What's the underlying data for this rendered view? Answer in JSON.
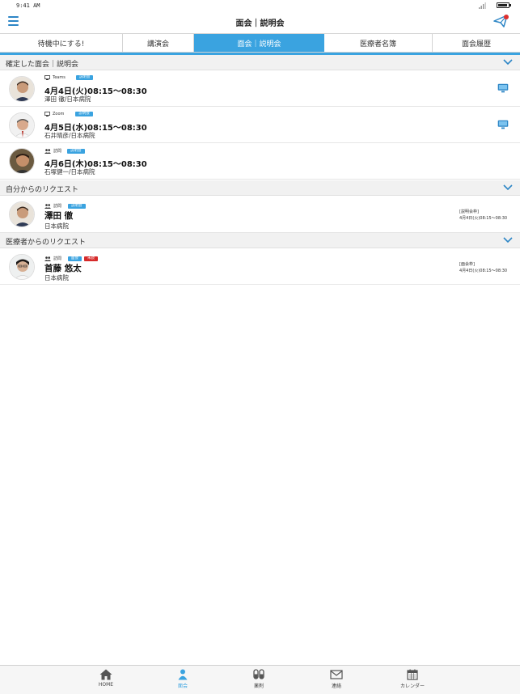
{
  "status_bar": {
    "time": "9:41 AM",
    "signal_icon": "signal-icon",
    "battery_icon": "battery-icon"
  },
  "header": {
    "title": "面会｜説明会",
    "menu_icon": "hamburger-menu-icon",
    "send_icon": "paper-plane-icon"
  },
  "tabs": [
    {
      "label": "待機中にする!",
      "active": false
    },
    {
      "label": "講演会",
      "active": false
    },
    {
      "label": "面会｜説明会",
      "active": true
    },
    {
      "label": "医療者名簿",
      "active": false
    },
    {
      "label": "面会履歴",
      "active": false
    }
  ],
  "confirmed": {
    "title": "確定した面会｜説明会",
    "items": [
      {
        "type": "Teams",
        "badge": "説明会",
        "when": "4月4日(火)08:15〜08:30",
        "sub": "澤田 徹/日本病院"
      },
      {
        "type": "Zoom",
        "badge": "説明会",
        "when": "4月5日(水)08:15〜08:30",
        "sub": "石井晴彦/日本病院"
      },
      {
        "type": "訪問",
        "badge": "説明会",
        "when": "4月6日(木)08:15〜08:30",
        "sub": "石塚健一/日本病院"
      }
    ]
  },
  "my_requests": {
    "title": "自分からのリクエスト",
    "items": [
      {
        "type": "訪問",
        "badge": "説明会",
        "name": "澤田 徹",
        "hospital": "日本病院",
        "note_label": "[説明会枠]",
        "note_time": "4月4日(火)08:15〜08:30"
      }
    ]
  },
  "their_requests": {
    "title": "医療者からのリクエスト",
    "items": [
      {
        "type": "訪問",
        "badge": "面会",
        "badge2": "未読",
        "name": "首藤 悠太",
        "hospital": "日本病院",
        "note_label": "[面会枠]",
        "note_time": "4月4日(火)08:15〜08:30"
      }
    ]
  },
  "bottom_nav": [
    {
      "label": "HOME",
      "icon": "home-icon",
      "active": false
    },
    {
      "label": "面会",
      "icon": "person-group-icon",
      "active": true
    },
    {
      "label": "薬剤",
      "icon": "pills-icon",
      "active": false
    },
    {
      "label": "連絡",
      "icon": "envelope-icon",
      "active": false
    },
    {
      "label": "カレンダー",
      "icon": "calendar-icon",
      "active": false
    }
  ],
  "colors": {
    "accent": "#3aa3e0",
    "menu_blue": "#2d86c6",
    "unread_red": "#d62a2a",
    "notify_dot": "#e0302e"
  }
}
